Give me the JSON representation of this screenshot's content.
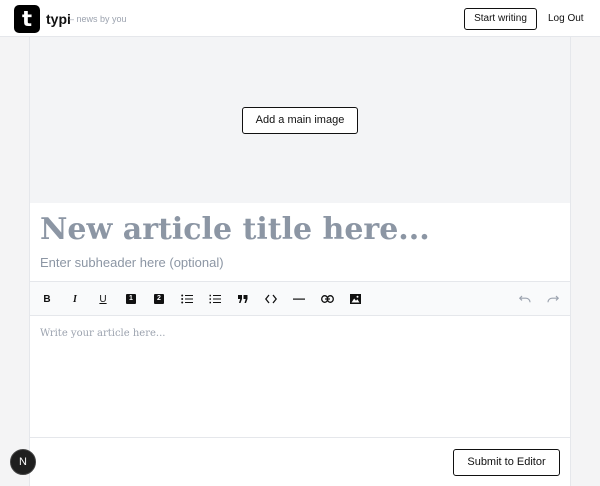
{
  "header": {
    "logo_letter": "t",
    "brand": "typi",
    "tagline": "– news by you",
    "start_writing_label": "Start writing",
    "logout_label": "Log Out"
  },
  "hero": {
    "add_image_label": "Add a main image"
  },
  "article": {
    "title_placeholder": "New article title here...",
    "subheader_placeholder": "Enter subheader here (optional)",
    "body_placeholder": "Write your article here..."
  },
  "toolbar": {
    "bold_label": "B",
    "italic_label": "I",
    "underline_label": "U",
    "h1_label": "1",
    "h2_label": "2",
    "items": [
      "bold-icon",
      "italic-icon",
      "underline-icon",
      "heading-1-icon",
      "heading-2-icon",
      "bullet-list-icon",
      "ordered-list-icon",
      "blockquote-icon",
      "code-icon",
      "horizontal-rule-icon",
      "link-icon",
      "image-icon",
      "undo-icon",
      "redo-icon"
    ]
  },
  "footer": {
    "submit_label": "Submit to Editor",
    "fab_letter": "N"
  },
  "colors": {
    "page_bg": "#f4f4f5",
    "hero_bg": "#f3f4f6",
    "placeholder": "#8c96a4",
    "accent": "#000000"
  }
}
